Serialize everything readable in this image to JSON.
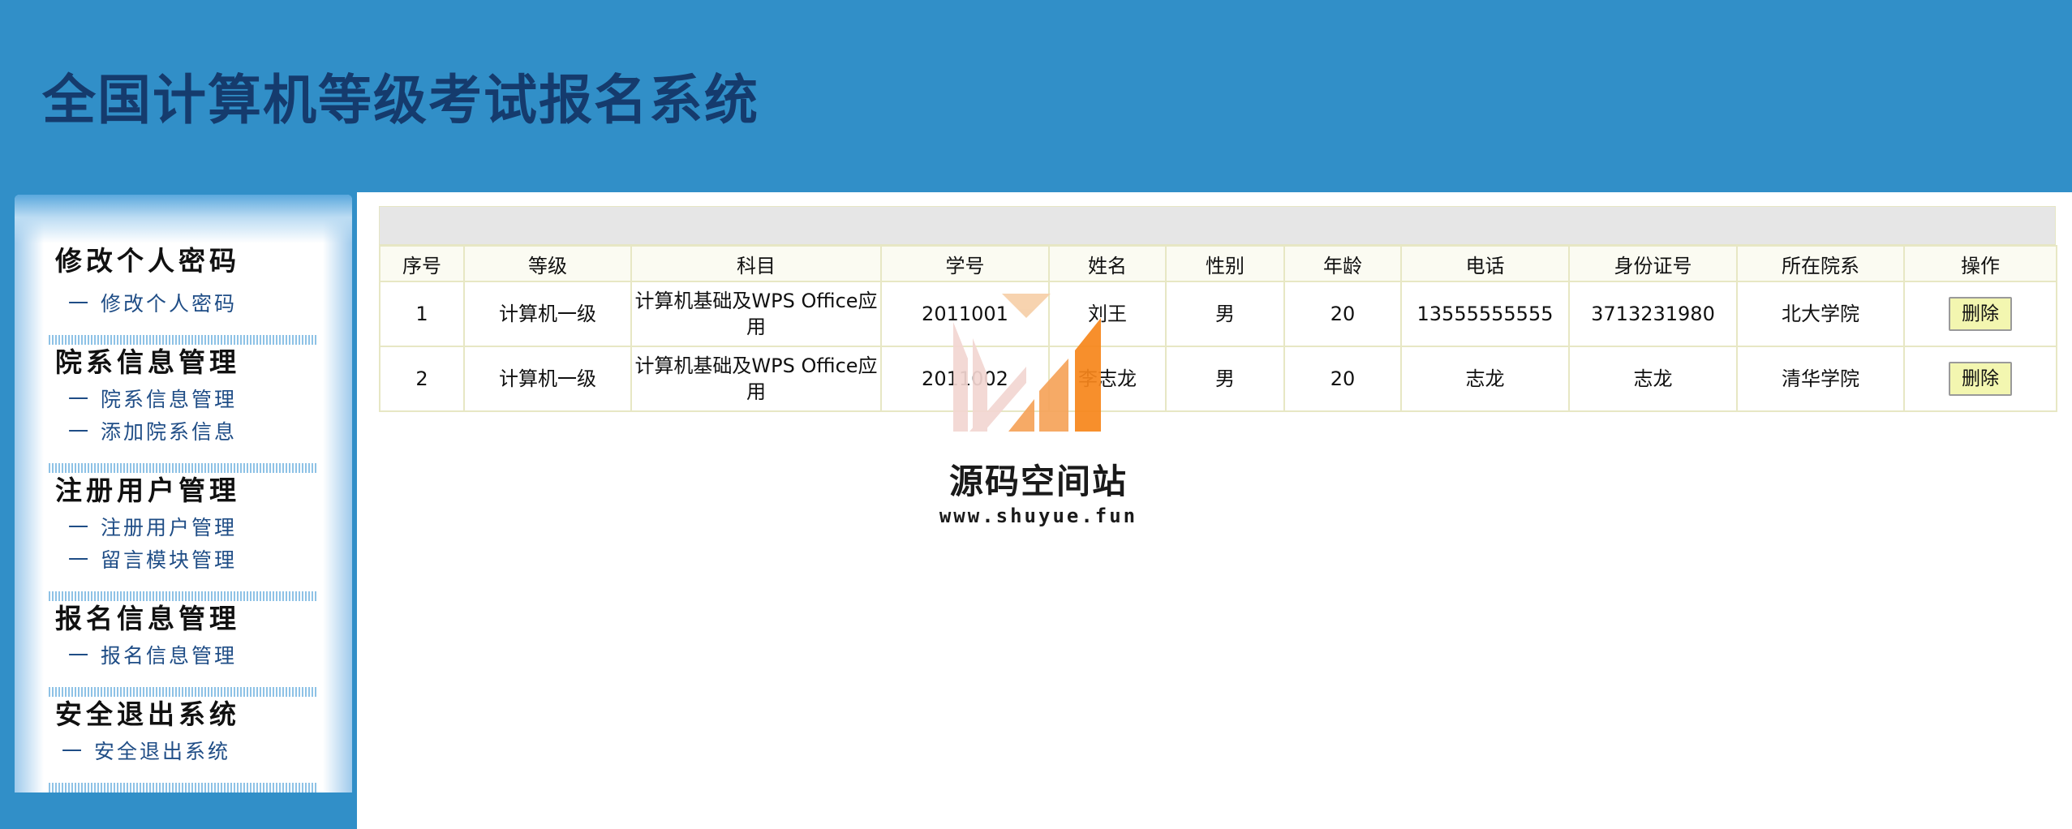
{
  "header": {
    "title": "全国计算机等级考试报名系统"
  },
  "sidebar": {
    "sections": [
      {
        "title": "修改个人密码",
        "items": [
          "修改个人密码"
        ]
      },
      {
        "title": "院系信息管理",
        "items": [
          "院系信息管理",
          "添加院系信息"
        ]
      },
      {
        "title": "注册用户管理",
        "items": [
          "注册用户管理",
          "留言模块管理"
        ]
      },
      {
        "title": "报名信息管理",
        "items": [
          "报名信息管理"
        ]
      },
      {
        "title": "安全退出系统",
        "items": [
          "安全退出系统"
        ]
      }
    ],
    "dash": "一"
  },
  "table": {
    "columns": [
      "序号",
      "等级",
      "科目",
      "学号",
      "姓名",
      "性别",
      "年龄",
      "电话",
      "身份证号",
      "所在院系",
      "操作"
    ],
    "rows": [
      [
        "1",
        "计算机一级",
        "计算机基础及WPS Office应用",
        "2011001",
        "刘王",
        "男",
        "20",
        "13555555555",
        "3713231980",
        "北大学院",
        "删除"
      ],
      [
        "2",
        "计算机一级",
        "计算机基础及WPS Office应用",
        "2011002",
        "李志龙",
        "男",
        "20",
        "志龙",
        "志龙",
        "清华学院",
        "删除"
      ]
    ]
  },
  "watermark": {
    "name": "源码空间站",
    "url": "www.shuyue.fun",
    "colors": [
      "#f3d6d2",
      "#f6a35a",
      "#f7861b"
    ]
  },
  "colors": {
    "header_bg": "#318fc8",
    "title_text": "#153b6d",
    "sidebar_link": "#1f4d86",
    "table_border": "#e7e7c4",
    "delete_button_bg": "#f3f6b0"
  }
}
